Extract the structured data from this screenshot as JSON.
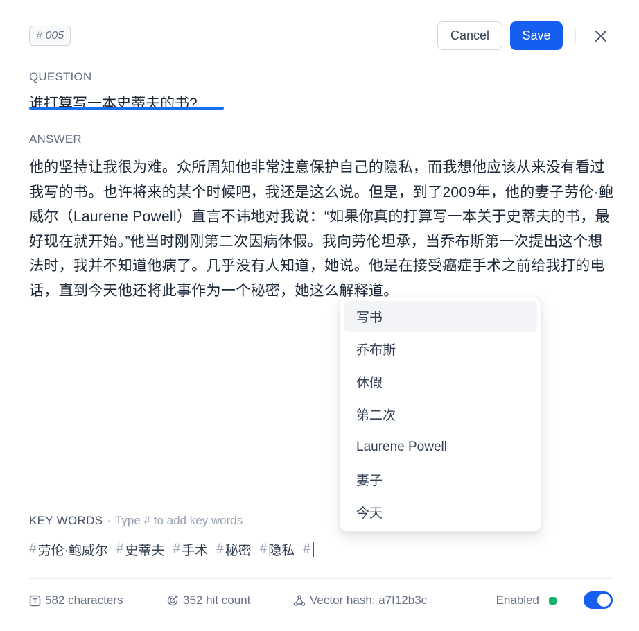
{
  "header": {
    "id_hash": "#",
    "id_value": "005",
    "cancel_label": "Cancel",
    "save_label": "Save"
  },
  "question": {
    "label": "QUESTION",
    "text": "谁打算写一本史蒂夫的书?"
  },
  "answer": {
    "label": "ANSWER",
    "text": "他的坚持让我很为难。众所周知他非常注意保护自己的隐私，而我想他应该从来没有看过我写的书。也许将来的某个时候吧，我还是这么说。但是，到了2009年，他的妻子劳伦·鲍威尔（Laurene Powell）直言不讳地对我说：“如果你真的打算写一本关于史蒂夫的书，最好现在就开始。”他当时刚刚第二次因病休假。我向劳伦坦承，当乔布斯第一次提出这个想法时，我并不知道他病了。几乎没有人知道，她说。他是在接受癌症手术之前给我打的电话，直到今天他还将此事作为一个秘密，她这么解释道。"
  },
  "suggestions": {
    "items": [
      "写书",
      "乔布斯",
      "休假",
      "第二次",
      "Laurene Powell",
      "妻子",
      "今天"
    ],
    "active_index": 0
  },
  "keywords": {
    "title": "KEY WORDS",
    "separator": "·",
    "hint": "Type # to add key words",
    "hash": "#",
    "tags": [
      "劳伦·鲍威尔",
      "史蒂夫",
      "手术",
      "秘密",
      "隐私"
    ]
  },
  "footer": {
    "characters": "582 characters",
    "hit_count": "352 hit count",
    "vector_hash": "Vector hash: a7f12b3c",
    "enabled_label": "Enabled",
    "enabled": true
  },
  "colors": {
    "primary": "#155eef",
    "underline": "#1570ef",
    "status_green": "#17b26a"
  },
  "icons": {
    "close": "close-icon",
    "characters": "text-box-icon",
    "hit_count": "target-icon",
    "vector_hash": "vector-nodes-icon"
  }
}
